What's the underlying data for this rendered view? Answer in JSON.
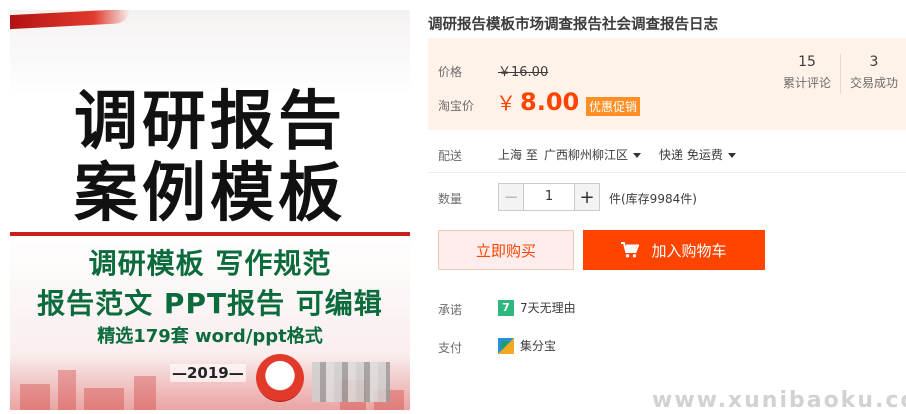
{
  "product_image": {
    "title_line1": "调研报告",
    "title_line2": "案例模板",
    "sub_line1": "调研模板 写作规范",
    "sub_line2": "报告范文 PPT报告 可编辑",
    "sub_line3": "精选179套 word/ppt格式",
    "year": "—2019—"
  },
  "title": "调研报告模板市场调查报告社会调查报告日志",
  "price": {
    "label": "价格",
    "original": "￥16.00",
    "promo_label": "淘宝价",
    "promo_currency": "￥",
    "promo_value": "8.00",
    "promo_tag": "优惠促销"
  },
  "stats": [
    {
      "value": "15",
      "label": "累计评论"
    },
    {
      "value": "3",
      "label": "交易成功"
    }
  ],
  "delivery": {
    "label": "配送",
    "from": "上海 至",
    "to": "广西柳州柳江区",
    "shipping": "快递 免运费"
  },
  "quantity": {
    "label": "数量",
    "minus": "−",
    "value": "1",
    "plus": "+",
    "stock": "件(库存9984件)"
  },
  "actions": {
    "buy_now": "立即购买",
    "add_to_cart": "加入购物车"
  },
  "promise": {
    "label": "承诺",
    "badge": "7",
    "text": "7天无理由"
  },
  "payment": {
    "label": "支付",
    "text": "集分宝"
  },
  "watermark": "www.xunibaoku.com",
  "colors": {
    "accent": "#ff4400",
    "price_bg": "#fff2e8",
    "promo_tag": "#ff8f24",
    "badge_green": "#2eb87d"
  }
}
